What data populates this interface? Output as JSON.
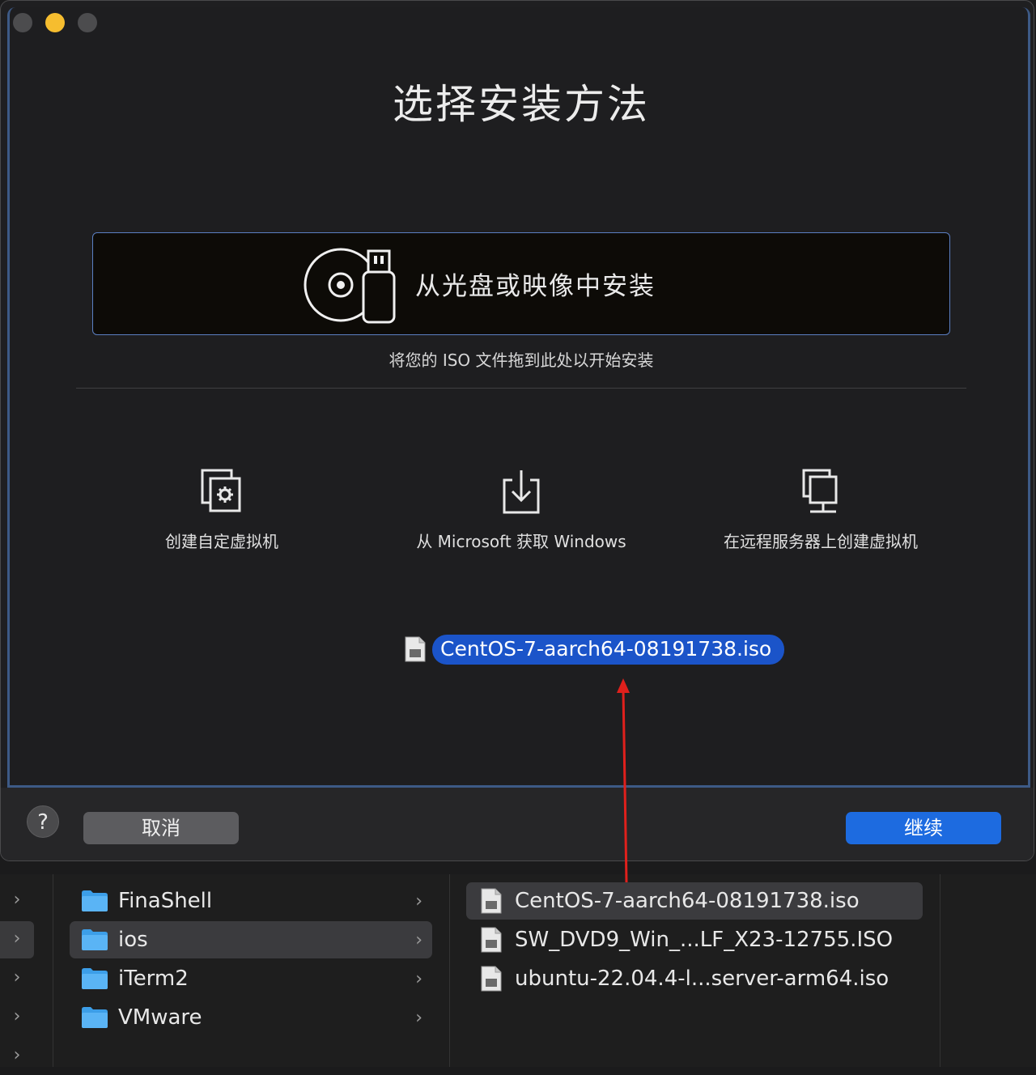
{
  "dialog": {
    "title": "选择安装方法",
    "drop_zone_label": "从光盘或映像中安装",
    "drop_hint": "将您的 ISO 文件拖到此处以开始安装",
    "options": [
      {
        "label": "创建自定虚拟机",
        "icon": "custom-vm-gear-icon"
      },
      {
        "label": "从 Microsoft 获取 Windows",
        "icon": "download-icon"
      },
      {
        "label": "在远程服务器上创建虚拟机",
        "icon": "remote-server-icon"
      }
    ],
    "dragged_file": "CentOS-7-aarch64-08191738.iso",
    "help_label": "?",
    "cancel_label": "取消",
    "continue_label": "继续"
  },
  "finder": {
    "folders": [
      {
        "name": "FinaShell",
        "selected": false
      },
      {
        "name": "ios",
        "selected": true
      },
      {
        "name": "iTerm2",
        "selected": false
      },
      {
        "name": "VMware",
        "selected": false
      }
    ],
    "files": [
      {
        "name": "CentOS-7-aarch64-08191738.iso",
        "selected": true
      },
      {
        "name": "SW_DVD9_Win_...LF_X23-12755.ISO",
        "selected": false
      },
      {
        "name": "ubuntu-22.04.4-l...server-arm64.iso",
        "selected": false
      }
    ]
  },
  "colors": {
    "accent": "#1d6be0",
    "selection": "#1b54c9",
    "annotation_arrow": "#e0201c"
  }
}
